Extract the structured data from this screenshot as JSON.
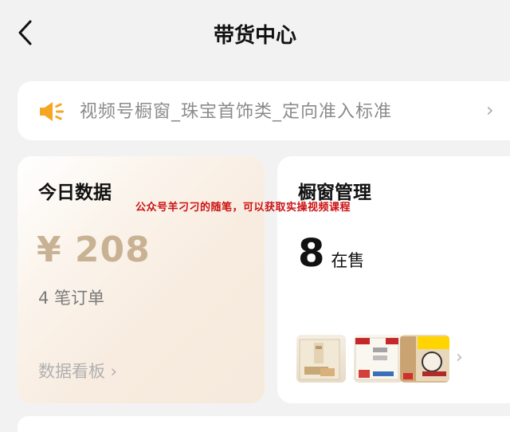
{
  "header": {
    "back_icon": "chevron-left-icon",
    "title": "带货中心"
  },
  "notice": {
    "icon": "speaker-icon",
    "text": "视频号橱窗_珠宝首饰类_定向准入标准",
    "chevron": "›"
  },
  "today": {
    "title": "今日数据",
    "amount": "¥ 208",
    "orders": "4 笔订单",
    "dashboard_label": "数据看板 ›"
  },
  "window": {
    "title": "橱窗管理",
    "count": "8",
    "count_unit": "在售",
    "chevron": "›"
  },
  "watermark": "公众号羊刁刁的随笔，可以获取实操视频课程",
  "colors": {
    "accent_gold": "#c9b293",
    "speaker_orange": "#f5a623",
    "watermark_red": "#cc1111"
  }
}
